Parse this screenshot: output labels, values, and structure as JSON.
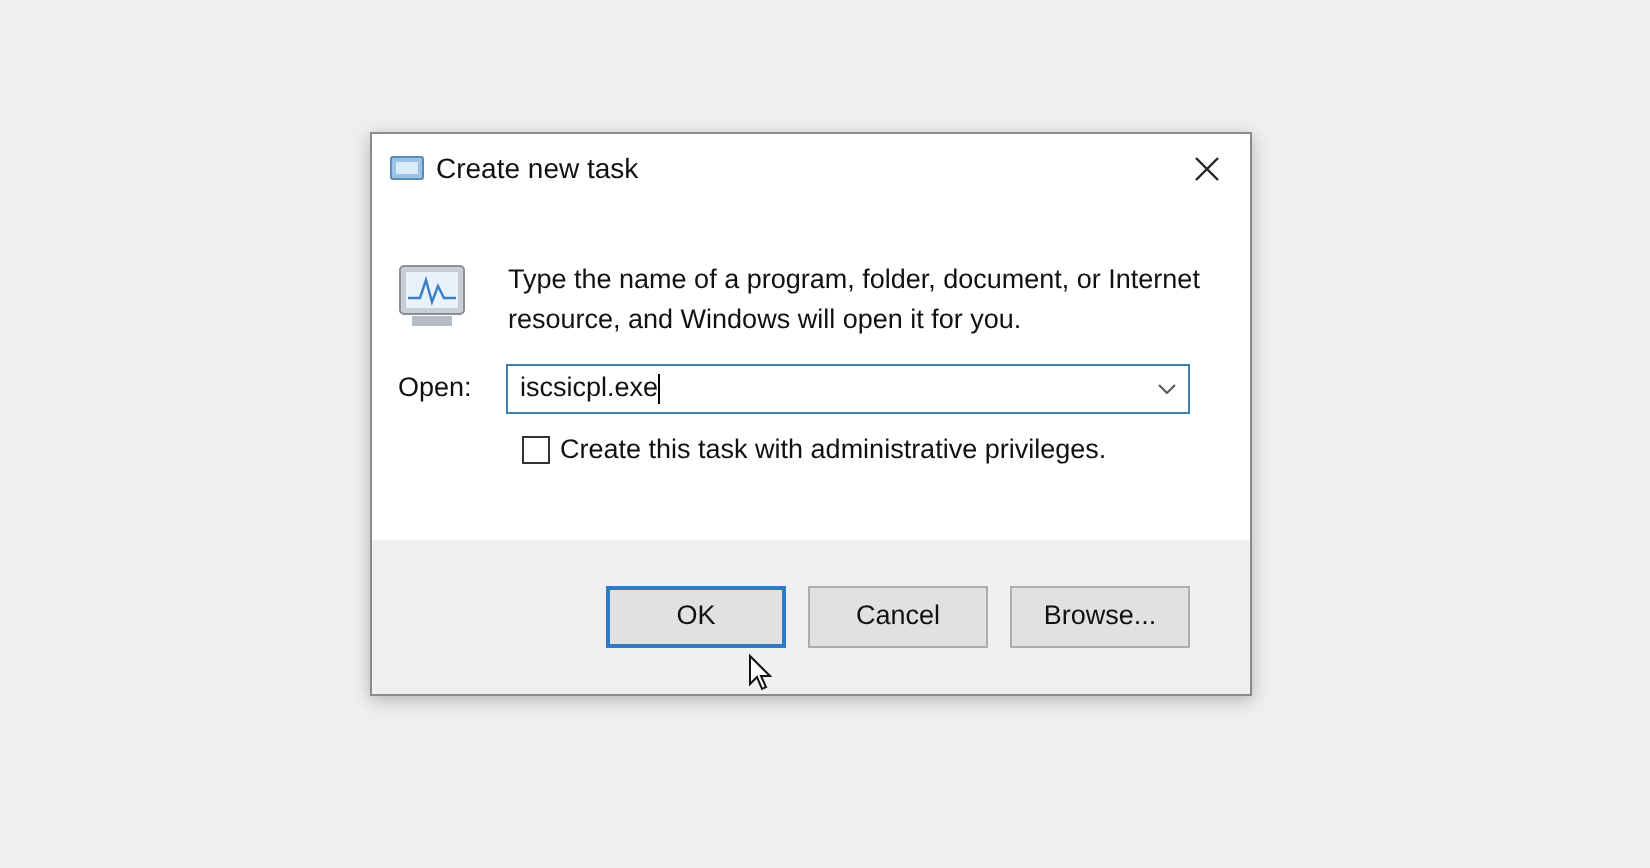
{
  "window": {
    "title": "Create new task"
  },
  "message": "Type the name of a program, folder, document, or Internet resource, and Windows will open it for you.",
  "open_field": {
    "label": "Open:",
    "value": "iscsicpl.exe"
  },
  "admin_checkbox": {
    "label": "Create this task with administrative privileges.",
    "checked": false
  },
  "buttons": [
    {
      "label": "OK",
      "default": true
    },
    {
      "label": "Cancel",
      "default": false
    },
    {
      "label": "Browse...",
      "default": false
    }
  ]
}
